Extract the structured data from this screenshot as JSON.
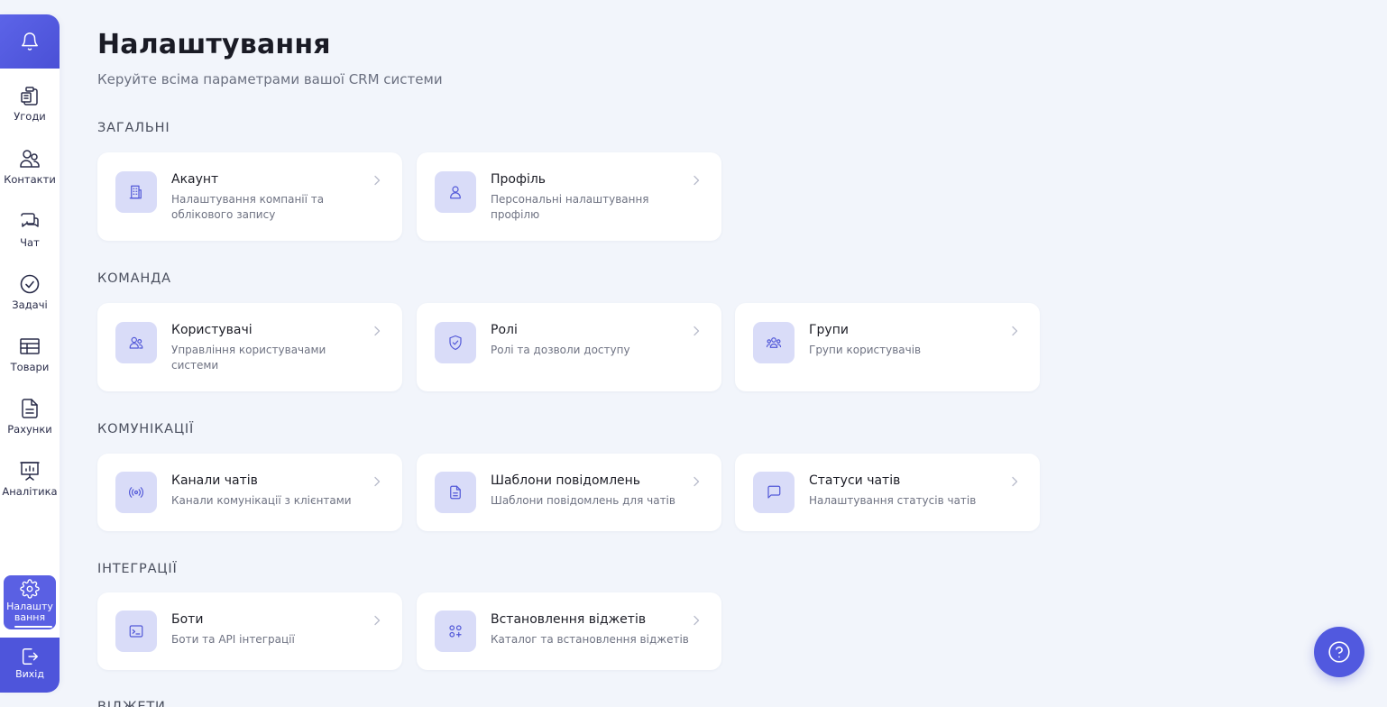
{
  "sidebar": {
    "items": [
      {
        "label": "Угоди",
        "icon": "clipboard-icon"
      },
      {
        "label": "Контакти",
        "icon": "users-icon"
      },
      {
        "label": "Чат",
        "icon": "chat-icon"
      },
      {
        "label": "Задачі",
        "icon": "check-circle-icon"
      },
      {
        "label": "Товари",
        "icon": "table-icon"
      },
      {
        "label": "Рахунки",
        "icon": "document-icon"
      },
      {
        "label": "Аналітика",
        "icon": "presentation-chart-icon"
      }
    ],
    "active": {
      "label": "Налашту вання",
      "icon": "gear-icon"
    },
    "logout": {
      "label": "Вихід",
      "icon": "logout-icon"
    }
  },
  "page": {
    "title": "Налаштування",
    "subtitle": "Керуйте всіма параметрами вашої CRM системи"
  },
  "sections": [
    {
      "title": "ЗАГАЛЬНІ",
      "cards": [
        {
          "title": "Акаунт",
          "desc": "Налаштування компанії та облікового запису",
          "icon": "building-icon"
        },
        {
          "title": "Профіль",
          "desc": "Персональні налаштування профілю",
          "icon": "user-icon"
        }
      ]
    },
    {
      "title": "КОМАНДА",
      "cards": [
        {
          "title": "Користувачі",
          "desc": "Управління користувачами системи",
          "icon": "users-icon"
        },
        {
          "title": "Ролі",
          "desc": "Ролі та дозволи доступу",
          "icon": "shield-icon"
        },
        {
          "title": "Групи",
          "desc": "Групи користувачів",
          "icon": "group-icon"
        }
      ]
    },
    {
      "title": "КОМУНІКАЦІЇ",
      "cards": [
        {
          "title": "Канали чатів",
          "desc": "Канали комунікації з клієнтами",
          "icon": "broadcast-icon"
        },
        {
          "title": "Шаблони повідомлень",
          "desc": "Шаблони повідомлень для чатів",
          "icon": "file-text-icon"
        },
        {
          "title": "Статуси чатів",
          "desc": "Налаштування статусів чатів",
          "icon": "message-square-icon"
        }
      ]
    },
    {
      "title": "ІНТЕГРАЦІЇ",
      "cards": [
        {
          "title": "Боти",
          "desc": "Боти та API інтеграції",
          "icon": "terminal-icon"
        },
        {
          "title": "Встановлення віджетів",
          "desc": "Каталог та встановлення віджетів",
          "icon": "widgets-icon"
        }
      ]
    },
    {
      "title": "ВІДЖЕТИ"
    }
  ],
  "colors": {
    "accent": "#5a60e3",
    "background": "#f2f5fb",
    "icon_bg": "#d9dcf8",
    "icon_stroke": "#5258d8"
  },
  "help": {
    "icon": "question-circle-icon"
  }
}
